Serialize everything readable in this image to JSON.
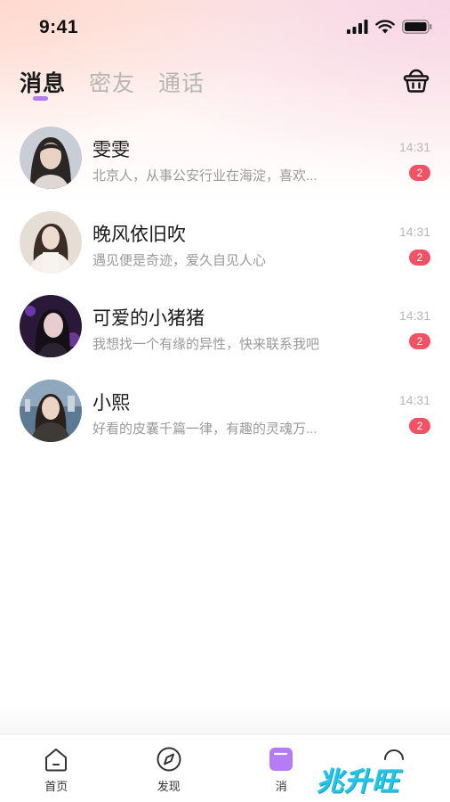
{
  "status_bar": {
    "time": "9:41"
  },
  "tabs": [
    {
      "label": "消息",
      "active": true
    },
    {
      "label": "密友",
      "active": false
    },
    {
      "label": "通话",
      "active": false
    }
  ],
  "header": {
    "right_icon": "basket-icon"
  },
  "messages": [
    {
      "name": "雯雯",
      "preview": "北京人，从事公安行业在海淀，喜欢...",
      "time": "14:31",
      "unread": "2"
    },
    {
      "name": "晚风依旧吹",
      "preview": "遇见便是奇迹，爱久自见人心",
      "time": "14:31",
      "unread": "2"
    },
    {
      "name": "可爱的小猪猪",
      "preview": "我想找一个有缘的异性，快来联系我吧",
      "time": "14:31",
      "unread": "2"
    },
    {
      "name": "小熙",
      "preview": "好看的皮囊千篇一律，有趣的灵魂万...",
      "time": "14:31",
      "unread": "2"
    }
  ],
  "tab_bar": {
    "items": [
      {
        "label": "首页",
        "icon": "home-icon"
      },
      {
        "label": "发现",
        "icon": "compass-icon"
      },
      {
        "label": "消",
        "icon": "message-icon",
        "active": true
      },
      {
        "label": "",
        "icon": "profile-icon"
      }
    ]
  },
  "watermark": "兆升旺",
  "colors": {
    "accent": "#b57cf5",
    "badge": "#f35264",
    "watermark": "#22c6e8"
  }
}
